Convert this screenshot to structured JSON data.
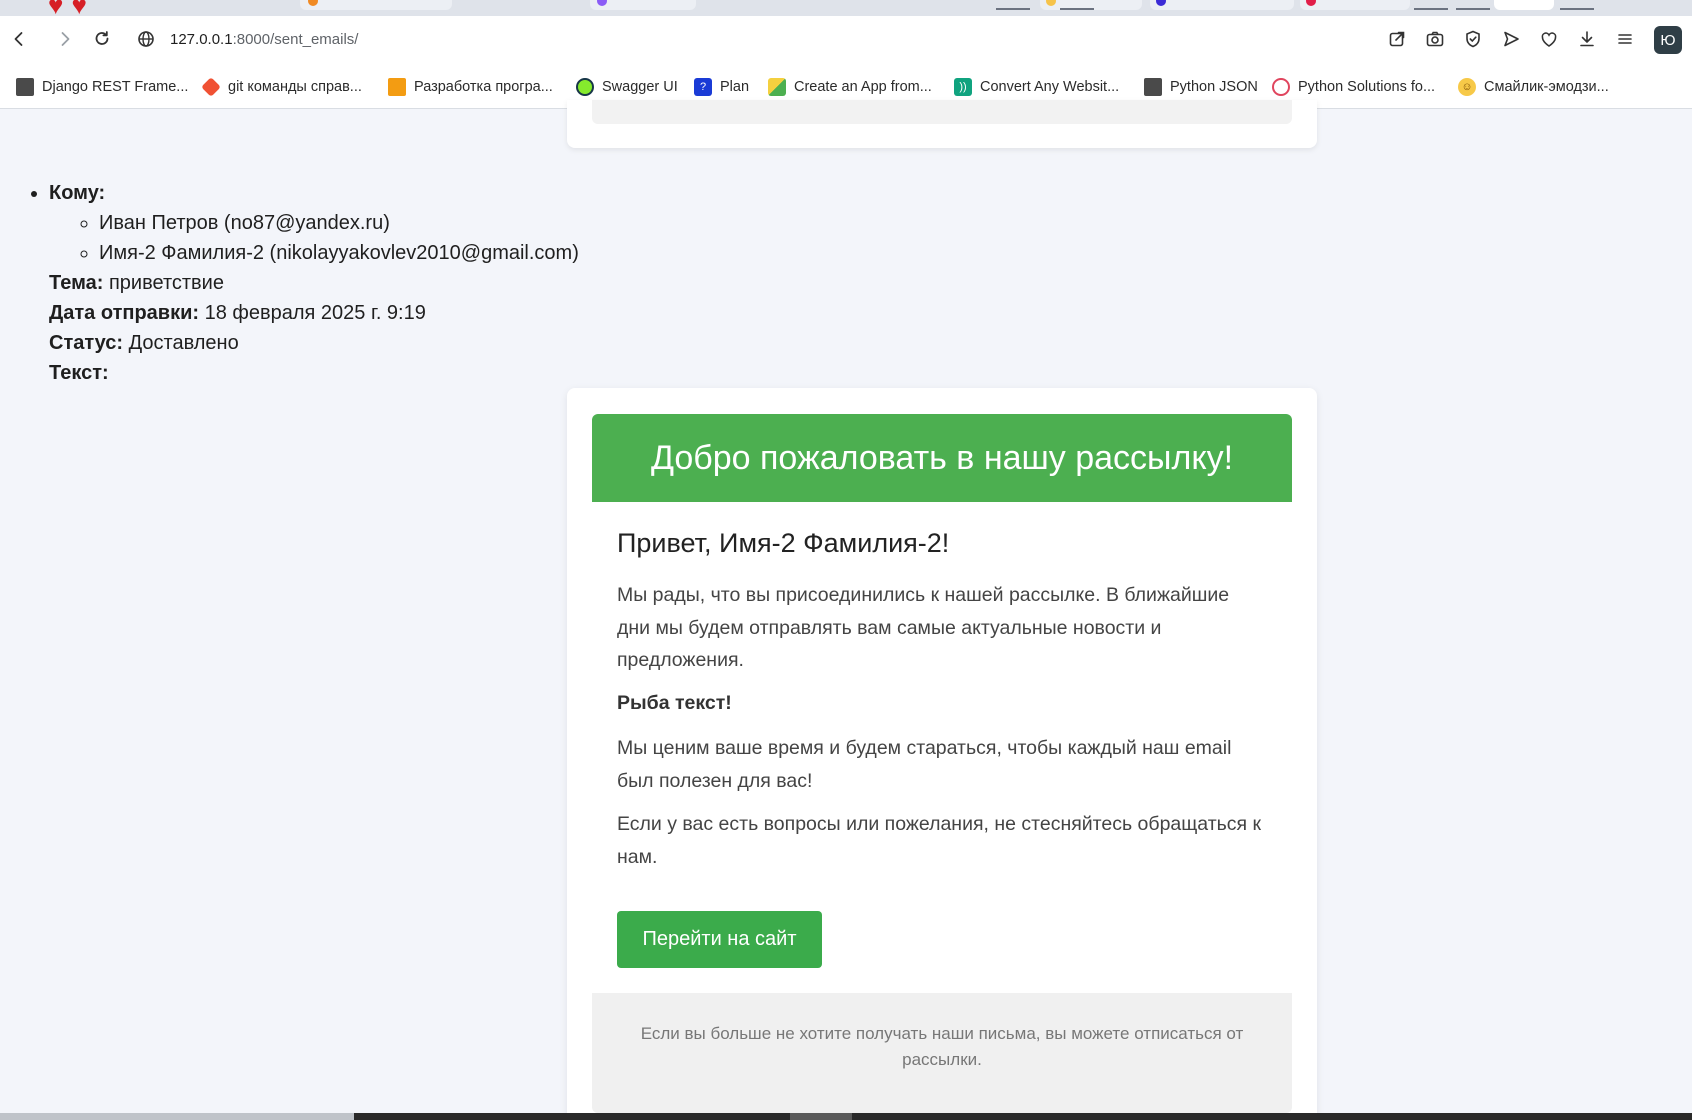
{
  "browser": {
    "url_host": "127.0.0.1",
    "url_path": ":8000/sent_emails/",
    "profile_initial": "Ю"
  },
  "bookmarks": [
    {
      "label": "Django REST Frame...",
      "icon": "file-icon"
    },
    {
      "label": "git команды справ...",
      "icon": "git-icon"
    },
    {
      "label": "Разработка програ...",
      "icon": "brand-icon"
    },
    {
      "label": "Swagger UI",
      "icon": "swagger-icon"
    },
    {
      "label": "Plan",
      "icon": "plan-icon"
    },
    {
      "label": "Create an App from...",
      "icon": "app-icon"
    },
    {
      "label": "Convert Any Websit...",
      "icon": "convert-icon"
    },
    {
      "label": "Python JSON",
      "icon": "file-icon"
    },
    {
      "label": "Python Solutions fo...",
      "icon": "openai-icon"
    },
    {
      "label": "Смайлик-эмодзи...",
      "icon": "smiley-icon"
    }
  ],
  "email_meta": {
    "to_label": "Кому:",
    "recipients": [
      "Иван Петров (no87@yandex.ru)",
      "Имя-2 Фамилия-2 (nikolayyakovlev2010@gmail.com)"
    ],
    "subject_label": "Тема:",
    "subject": "приветствие",
    "date_label": "Дата отправки:",
    "date": "18 февраля 2025 г. 9:19",
    "status_label": "Статус:",
    "status": "Доставлено",
    "text_label": "Текст:"
  },
  "email_body": {
    "header": "Добро пожаловать в нашу рассылку!",
    "greeting": "Привет, Имя-2 Фамилия-2!",
    "paragraph1": "Мы рады, что вы присоединились к нашей рассылке. В ближайшие дни мы будем отправлять вам самые актуальные новости и предложения.",
    "paragraph_bold": "Рыба текст!",
    "paragraph2": "Мы ценим ваше время и будем стараться, чтобы каждый наш email был полезен для вас!",
    "paragraph3": "Если у вас есть вопросы или пожелания, не стесняйтесь обращаться к нам.",
    "cta_label": "Перейти на сайт",
    "footer": "Если вы больше не хотите получать наши письма, вы можете отписаться от рассылки."
  },
  "colors": {
    "accent_green": "#4caf50",
    "button_green": "#3bab4b",
    "page_bg": "#f3f5fa"
  }
}
